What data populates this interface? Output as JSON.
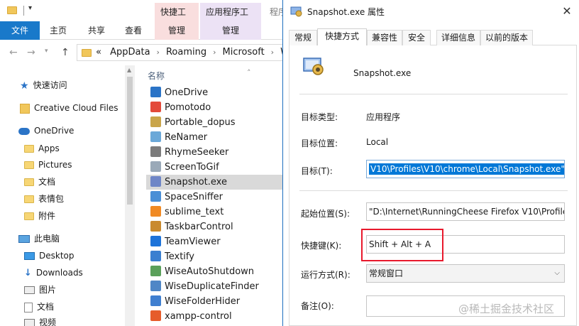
{
  "explorer": {
    "context_tabs": [
      "快捷工具",
      "应用程序工具",
      "程序"
    ],
    "ribbon_tabs": [
      "文件",
      "主页",
      "共享",
      "查看",
      "管理",
      "管理"
    ],
    "address": {
      "prefix": "«",
      "crumbs": [
        "AppData",
        "Roaming",
        "Microsoft",
        "Wi"
      ]
    },
    "nav_items": [
      {
        "label": "快速访问",
        "icon": "star-icon"
      },
      {
        "label": "Creative Cloud Files",
        "icon": "creative-cloud-icon"
      },
      {
        "label": "OneDrive",
        "icon": "onedrive-cloud-icon"
      },
      {
        "label": "Apps",
        "icon": "folder-icon"
      },
      {
        "label": "Pictures",
        "icon": "folder-icon"
      },
      {
        "label": "文档",
        "icon": "folder-icon"
      },
      {
        "label": "表情包",
        "icon": "folder-icon"
      },
      {
        "label": "附件",
        "icon": "folder-icon"
      },
      {
        "label": "此电脑",
        "icon": "this-pc-icon"
      },
      {
        "label": "Desktop",
        "icon": "desktop-icon"
      },
      {
        "label": "Downloads",
        "icon": "download-arrow-icon"
      },
      {
        "label": "图片",
        "icon": "pictures-icon"
      },
      {
        "label": "文档",
        "icon": "documents-icon"
      },
      {
        "label": "视频",
        "icon": "videos-icon"
      }
    ],
    "column_header": "名称",
    "files": [
      {
        "name": "OneDrive",
        "color": "#2b74c7"
      },
      {
        "name": "Pomotodo",
        "color": "#e34a3a"
      },
      {
        "name": "Portable_dopus",
        "color": "#c9a54a"
      },
      {
        "name": "ReNamer",
        "color": "#6aa8d8"
      },
      {
        "name": "RhymeSeeker",
        "color": "#7b7b7b"
      },
      {
        "name": "ScreenToGif",
        "color": "#9aa9b8"
      },
      {
        "name": "Snapshot.exe",
        "color": "#6f86c7"
      },
      {
        "name": "SpaceSniffer",
        "color": "#4a8fd6"
      },
      {
        "name": "sublime_text",
        "color": "#f08a24"
      },
      {
        "name": "TaskbarControl",
        "color": "#c98a2f"
      },
      {
        "name": "TeamViewer",
        "color": "#1e73d9"
      },
      {
        "name": "Textify",
        "color": "#3a7fd0"
      },
      {
        "name": "WiseAutoShutdown",
        "color": "#5aa05a"
      },
      {
        "name": "WiseDuplicateFinder",
        "color": "#4f86c6"
      },
      {
        "name": "WiseFolderHider",
        "color": "#3f7fd0"
      },
      {
        "name": "xampp-control",
        "color": "#e65c2b"
      }
    ],
    "selected_file": "Snapshot.exe"
  },
  "dialog": {
    "title": "Snapshot.exe 属性",
    "tabs": [
      "常规",
      "快捷方式",
      "兼容性",
      "安全",
      "详细信息",
      "以前的版本"
    ],
    "active_tab": "快捷方式",
    "app_name": "Snapshot.exe",
    "fields": {
      "type_label": "目标类型:",
      "type_value": "应用程序",
      "location_label": "目标位置:",
      "location_value": "Local",
      "target_label": "目标(T):",
      "target_value": "V10\\Profiles\\V10\\chrome\\Local\\Snapshot.exe\"",
      "start_label": "起始位置(S):",
      "start_value": "\"D:\\Internet\\RunningCheese Firefox V10\\Profile",
      "hotkey_label": "快捷键(K):",
      "hotkey_value": "Shift + Alt + A",
      "run_label": "运行方式(R):",
      "run_value": "常规窗口",
      "comment_label": "备注(O):",
      "comment_value": ""
    }
  },
  "watermark": "@稀土掘金技术社区",
  "colors": {
    "accent": "#1979ca",
    "highlight_box": "#e8192c",
    "selection": "#0078d7"
  }
}
